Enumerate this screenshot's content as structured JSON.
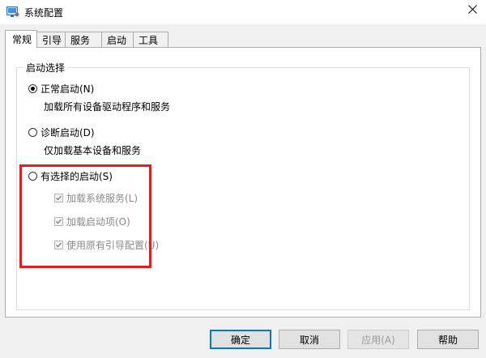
{
  "window": {
    "title": "系统配置",
    "app_icon": "msconfig-icon",
    "close_icon": "close-icon"
  },
  "tabs": [
    {
      "label": "常规",
      "active": true
    },
    {
      "label": "引导",
      "active": false
    },
    {
      "label": "服务",
      "active": false
    },
    {
      "label": "启动",
      "active": false
    },
    {
      "label": "工具",
      "active": false
    }
  ],
  "startup_selection": {
    "group_label": "启动选择",
    "normal": {
      "label": "正常启动(N)",
      "description": "加载所有设备驱动程序和服务",
      "checked": true
    },
    "diagnostic": {
      "label": "诊断启动(D)",
      "description": "仅加载基本设备和服务",
      "checked": false
    },
    "selective": {
      "label": "有选择的启动(S)",
      "checked": false,
      "options": [
        {
          "label": "加载系统服务(L)",
          "checked": true,
          "enabled": false
        },
        {
          "label": "加载启动项(O)",
          "checked": true,
          "enabled": false
        },
        {
          "label": "使用原有引导配置(U)",
          "checked": true,
          "enabled": false
        }
      ]
    }
  },
  "annotation": {
    "highlight_color": "#e0201e"
  },
  "buttons": {
    "ok": "确定",
    "cancel": "取消",
    "apply": "应用(A)",
    "help": "帮助"
  },
  "colors": {
    "accent": "#0078d7",
    "panel_bg": "#ffffff",
    "window_bg": "#f0f0f0"
  }
}
